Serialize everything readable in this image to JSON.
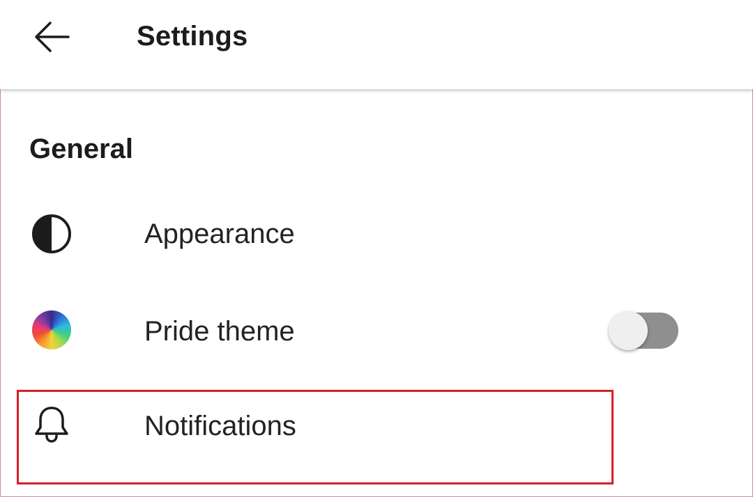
{
  "header": {
    "title": "Settings",
    "back_icon": "arrow-left-icon"
  },
  "general": {
    "heading": "General",
    "items": [
      {
        "label": "Appearance",
        "icon": "half-circle-contrast-icon"
      },
      {
        "label": "Pride theme",
        "icon": "rainbow-color-wheel-icon",
        "toggle": {
          "on": false
        }
      },
      {
        "label": "Notifications",
        "icon": "bell-icon"
      }
    ]
  },
  "colors": {
    "highlight_border": "#d61f26",
    "toggle_track_off": "#8f8f8f",
    "toggle_thumb": "#efefef"
  }
}
